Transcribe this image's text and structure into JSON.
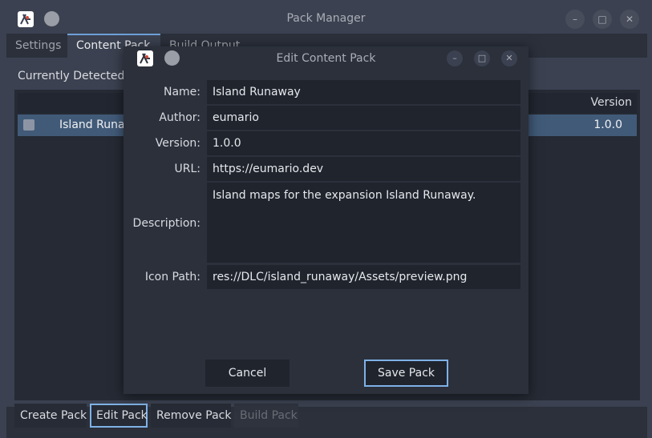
{
  "window": {
    "title": "Pack Manager",
    "tabs": [
      "Settings",
      "Content Pack",
      "Build Output"
    ],
    "minimize_glyph": "–",
    "maximize_glyph": "□",
    "close_glyph": "✕"
  },
  "content": {
    "detected_label": "Currently Detected Mods",
    "table": {
      "columns": [
        "",
        "Version"
      ],
      "rows": [
        {
          "name": "Island Runaway",
          "version": "1.0.0",
          "checked": false
        }
      ]
    }
  },
  "actions": {
    "create": "Create Pack",
    "edit": "Edit Pack",
    "remove": "Remove Pack",
    "build": "Build Pack"
  },
  "dialog": {
    "title": "Edit Content Pack",
    "fields": {
      "name_label": "Name:",
      "name_value": "Island Runaway",
      "author_label": "Author:",
      "author_value": "eumario",
      "version_label": "Version:",
      "version_value": "1.0.0",
      "url_label": "URL:",
      "url_value": "https://eumario.dev",
      "description_label": "Description:",
      "description_value": "Island maps for the expansion Island Runaway.",
      "icon_path_label": "Icon Path:",
      "icon_path_value": "res://DLC/island_runaway/Assets/preview.png"
    },
    "cancel": "Cancel",
    "save": "Save Pack"
  },
  "colors": {
    "accent": "#7fb1e6",
    "selection": "#415a78",
    "background": "#3b4150",
    "field": "#1f242d"
  },
  "icons": {
    "app_logo": "app-logo-icon",
    "app_menu": "circle-menu-icon",
    "minimize": "minimize-icon",
    "maximize": "maximize-icon",
    "close": "close-icon"
  }
}
